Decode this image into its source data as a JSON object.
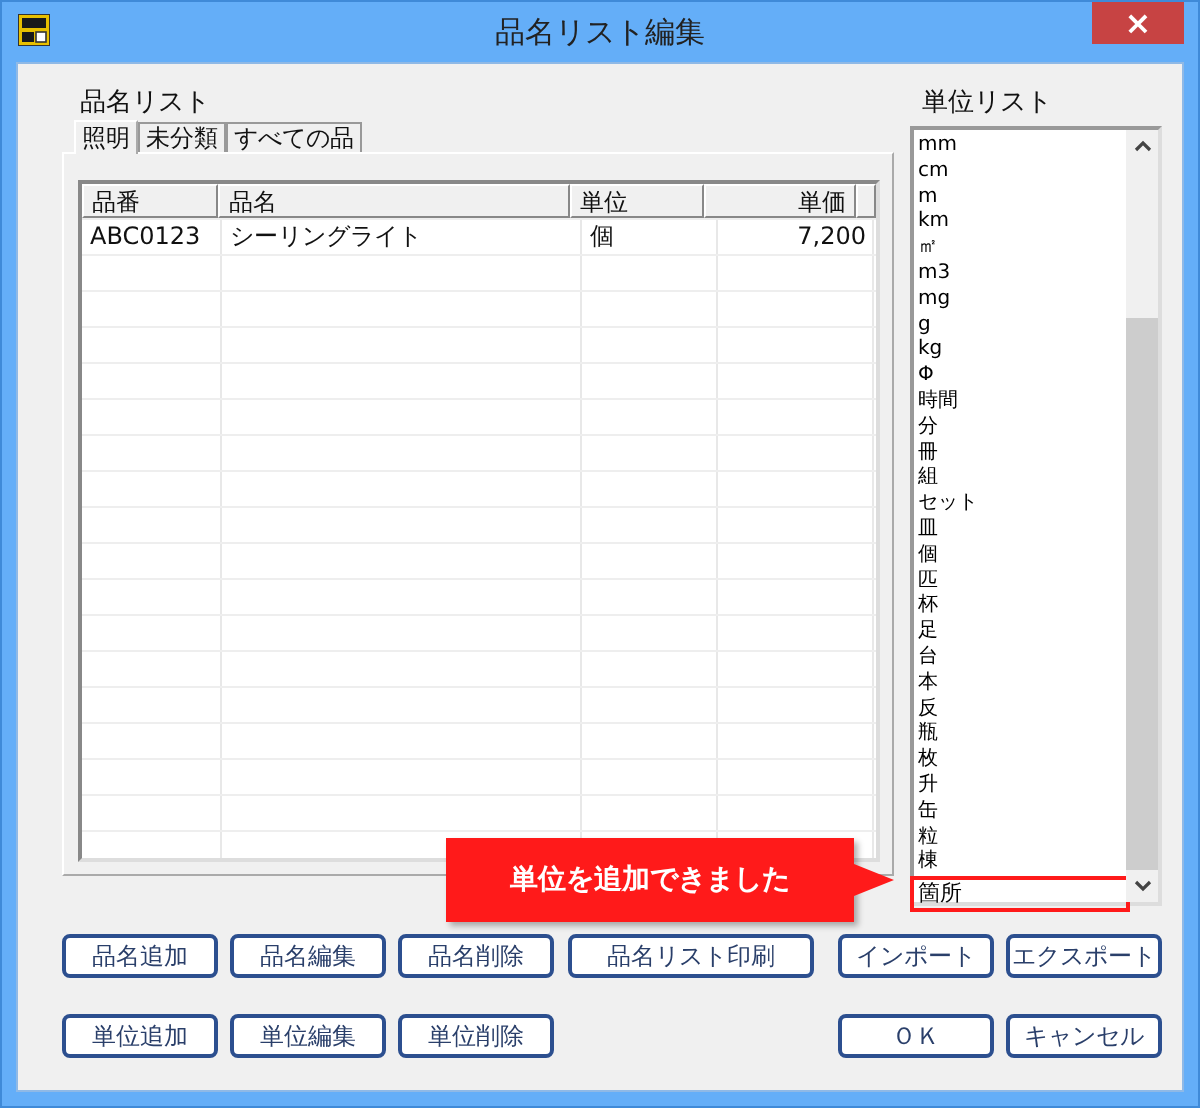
{
  "window": {
    "title": "品名リスト編集",
    "close": "×"
  },
  "item_list": {
    "label": "品名リスト",
    "tabs": [
      {
        "label": "照明",
        "selected": true
      },
      {
        "label": "未分類",
        "selected": false
      },
      {
        "label": "すべての品",
        "selected": false
      }
    ],
    "table": {
      "columns": [
        "品番",
        "品名",
        "単位",
        "単価"
      ],
      "rows": [
        [
          "ABC0123",
          "シーリングライト",
          "個",
          "7,200"
        ]
      ]
    }
  },
  "unit_list": {
    "label": "単位リスト",
    "items": [
      {
        "text": "mm",
        "highlighted": false
      },
      {
        "text": "cm",
        "highlighted": false
      },
      {
        "text": "m",
        "highlighted": false
      },
      {
        "text": "km",
        "highlighted": false
      },
      {
        "text": "㎡",
        "highlighted": false
      },
      {
        "text": "m3",
        "highlighted": false
      },
      {
        "text": "mg",
        "highlighted": false
      },
      {
        "text": "g",
        "highlighted": false
      },
      {
        "text": "kg",
        "highlighted": false
      },
      {
        "text": "Φ",
        "highlighted": false
      },
      {
        "text": "時間",
        "highlighted": false
      },
      {
        "text": "分",
        "highlighted": false
      },
      {
        "text": "冊",
        "highlighted": false
      },
      {
        "text": "組",
        "highlighted": false
      },
      {
        "text": "セット",
        "highlighted": false
      },
      {
        "text": "皿",
        "highlighted": false
      },
      {
        "text": "個",
        "highlighted": false
      },
      {
        "text": "匹",
        "highlighted": false
      },
      {
        "text": "杯",
        "highlighted": false
      },
      {
        "text": "足",
        "highlighted": false
      },
      {
        "text": "台",
        "highlighted": false
      },
      {
        "text": "本",
        "highlighted": false
      },
      {
        "text": "反",
        "highlighted": false
      },
      {
        "text": "瓶",
        "highlighted": false
      },
      {
        "text": "枚",
        "highlighted": false
      },
      {
        "text": "升",
        "highlighted": false
      },
      {
        "text": "缶",
        "highlighted": false
      },
      {
        "text": "粒",
        "highlighted": false
      },
      {
        "text": "棟",
        "highlighted": false
      },
      {
        "text": "箇所",
        "highlighted": true
      }
    ]
  },
  "callout": {
    "text": "単位を追加できました"
  },
  "button_rows": [
    [
      "品名追加",
      "品名編集",
      "品名削除",
      "品名リスト印刷",
      "インポート",
      "エクスポート"
    ],
    [
      "単位追加",
      "単位編集",
      "単位削除",
      "ＯＫ",
      "キャンセル"
    ]
  ]
}
